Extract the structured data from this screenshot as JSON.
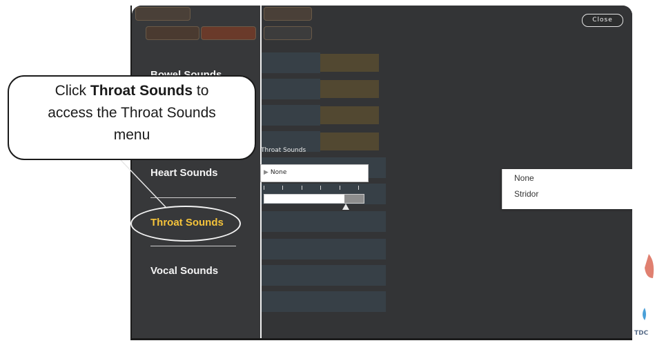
{
  "callout": {
    "prefix": "Click ",
    "bold": "Throat Sounds",
    "suffix": " to",
    "line2": "access the Throat Sounds",
    "line3": "menu"
  },
  "left_menu": {
    "items": [
      {
        "label": "Bowel Sounds"
      },
      {
        "label": "Heart Sounds"
      },
      {
        "label": "Throat Sounds"
      },
      {
        "label": "Vocal Sounds"
      }
    ]
  },
  "close_button": "Close",
  "throat_panel": {
    "label": "Throat Sounds",
    "selected_value": "None",
    "options": [
      "None",
      "Stridor"
    ]
  },
  "brand_text": "TDC",
  "colors": {
    "active_menu": "#f5c33a",
    "background": "#3a3b3c"
  }
}
